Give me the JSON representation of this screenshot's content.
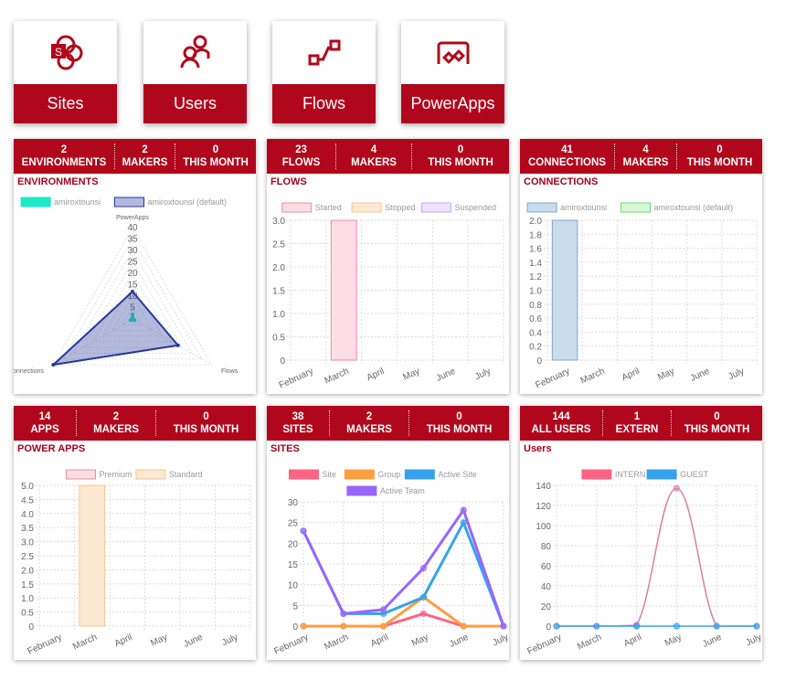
{
  "tiles": [
    {
      "label": "Sites",
      "icon": "sharepoint-icon"
    },
    {
      "label": "Users",
      "icon": "users-icon"
    },
    {
      "label": "Flows",
      "icon": "flow-icon"
    },
    {
      "label": "PowerApps",
      "icon": "powerapps-icon"
    }
  ],
  "cards": {
    "environments": {
      "stats": [
        {
          "value": "2",
          "label": "ENVIRONMENTS"
        },
        {
          "value": "2",
          "label": "MAKERS"
        },
        {
          "value": "0",
          "label": "THIS MONTH"
        }
      ],
      "title": "ENVIRONMENTS"
    },
    "flows": {
      "stats": [
        {
          "value": "23",
          "label": "FLOWS"
        },
        {
          "value": "4",
          "label": "MAKERS"
        },
        {
          "value": "0",
          "label": "THIS MONTH"
        }
      ],
      "title": "FLOWS"
    },
    "connections": {
      "stats": [
        {
          "value": "41",
          "label": "CONNECTIONS"
        },
        {
          "value": "4",
          "label": "MAKERS"
        },
        {
          "value": "0",
          "label": "THIS MONTH"
        }
      ],
      "title": "CONNECTIONS"
    },
    "powerapps": {
      "stats": [
        {
          "value": "14",
          "label": "APPS"
        },
        {
          "value": "2",
          "label": "MAKERS"
        },
        {
          "value": "0",
          "label": "THIS MONTH"
        }
      ],
      "title": "POWER APPS"
    },
    "sites": {
      "stats": [
        {
          "value": "38",
          "label": "SITES"
        },
        {
          "value": "2",
          "label": "MAKERS"
        },
        {
          "value": "0",
          "label": "THIS MONTH"
        }
      ],
      "title": "SITES"
    },
    "users": {
      "stats": [
        {
          "value": "144",
          "label": "ALL USERS"
        },
        {
          "value": "1",
          "label": "EXTERN"
        },
        {
          "value": "0",
          "label": "THIS MONTH"
        }
      ],
      "title": "Users"
    }
  },
  "colors": {
    "brand": "#b0071c",
    "title": "#a0061c"
  },
  "chart_data": [
    {
      "id": "environments",
      "type": "radar",
      "labels": [
        "PowerApps",
        "Flows",
        "Connections"
      ],
      "rlim": [
        0,
        40
      ],
      "ticks": [
        "5",
        "10",
        "15",
        "20",
        "25",
        "30",
        "35",
        "40"
      ],
      "series": [
        {
          "name": "amiroxtounsi",
          "values": [
            2,
            1,
            1
          ],
          "color": "#1de9c6",
          "fill": "#1de9c6"
        },
        {
          "name": "amiroxtounsi (default)",
          "values": [
            12,
            23,
            40
          ],
          "color": "#25389c",
          "fill": "rgba(37,56,156,0.35)"
        }
      ]
    },
    {
      "id": "flows",
      "type": "bar",
      "categories": [
        "February",
        "March",
        "April",
        "May",
        "June",
        "July"
      ],
      "ylim": [
        0,
        3
      ],
      "yticks": [
        "0",
        "0.5",
        "1.0",
        "1.5",
        "2.0",
        "2.5",
        "3.0"
      ],
      "series": [
        {
          "name": "Started",
          "values": [
            0,
            3,
            0,
            0,
            0,
            0
          ],
          "color": "#f28ba0",
          "fill": "#fcdde3"
        },
        {
          "name": "Stopped",
          "values": [
            0,
            0,
            0,
            0,
            0,
            0
          ],
          "color": "#f8c48e",
          "fill": "#fde9d3"
        },
        {
          "name": "Suspended",
          "values": [
            0,
            0,
            0,
            0,
            0,
            0
          ],
          "color": "#c7a7f5",
          "fill": "#ede3fd"
        }
      ]
    },
    {
      "id": "connections",
      "type": "bar",
      "categories": [
        "February",
        "March",
        "April",
        "May",
        "June",
        "July"
      ],
      "ylim": [
        0,
        2
      ],
      "yticks": [
        "0",
        "0.2",
        "0.4",
        "0.6",
        "0.8",
        "1.0",
        "1.2",
        "1.4",
        "1.6",
        "1.8",
        "2.0"
      ],
      "series": [
        {
          "name": "amiroxtounsi",
          "values": [
            2,
            0,
            0,
            0,
            0,
            0
          ],
          "color": "#7fa8cc",
          "fill": "#c8dcec"
        },
        {
          "name": "amiroxtounsi (default)",
          "values": [
            0,
            0,
            0,
            0,
            0,
            0
          ],
          "color": "#66e066",
          "fill": "#d9f7d9"
        }
      ]
    },
    {
      "id": "powerapps",
      "type": "bar",
      "categories": [
        "February",
        "March",
        "April",
        "May",
        "June",
        "July"
      ],
      "ylim": [
        0,
        5
      ],
      "yticks": [
        "0",
        "0.5",
        "1.0",
        "1.5",
        "2.0",
        "2.5",
        "3.0",
        "3.5",
        "4.0",
        "4.5",
        "5.0"
      ],
      "series": [
        {
          "name": "Premium",
          "values": [
            0,
            0,
            0,
            0,
            0,
            0
          ],
          "color": "#f28ba0",
          "fill": "#fcdde3"
        },
        {
          "name": "Standard",
          "values": [
            0,
            5,
            0,
            0,
            0,
            0
          ],
          "color": "#f8c48e",
          "fill": "#fde9d3"
        }
      ]
    },
    {
      "id": "sites",
      "type": "line",
      "categories": [
        "February",
        "March",
        "April",
        "May",
        "June",
        "July"
      ],
      "ylim": [
        0,
        30
      ],
      "yticks": [
        "0",
        "5",
        "10",
        "15",
        "20",
        "25",
        "30"
      ],
      "series": [
        {
          "name": "Site",
          "values": [
            0,
            0,
            0,
            3,
            0,
            0
          ],
          "color": "#ff6384"
        },
        {
          "name": "Group",
          "values": [
            0,
            0,
            0,
            7,
            0,
            0
          ],
          "color": "#ff9f40"
        },
        {
          "name": "Active Site",
          "values": [
            23,
            3,
            3,
            7,
            25,
            0
          ],
          "color": "#36a2eb"
        },
        {
          "name": "Active Team",
          "values": [
            23,
            3,
            4,
            14,
            28,
            0
          ],
          "color": "#9966ff"
        }
      ]
    },
    {
      "id": "users",
      "type": "line",
      "categories": [
        "February",
        "March",
        "April",
        "May",
        "June",
        "July"
      ],
      "ylim": [
        0,
        140
      ],
      "yticks": [
        "0",
        "20",
        "40",
        "60",
        "80",
        "100",
        "120",
        "140"
      ],
      "series": [
        {
          "name": "INTERN",
          "values": [
            0,
            0,
            1,
            137,
            0,
            0
          ],
          "color": "#d580a8",
          "legend": "#ff6384"
        },
        {
          "name": "GUEST",
          "values": [
            0,
            0,
            0,
            0,
            0,
            0
          ],
          "color": "#36a2eb",
          "legend": "#36a2eb"
        }
      ]
    }
  ]
}
